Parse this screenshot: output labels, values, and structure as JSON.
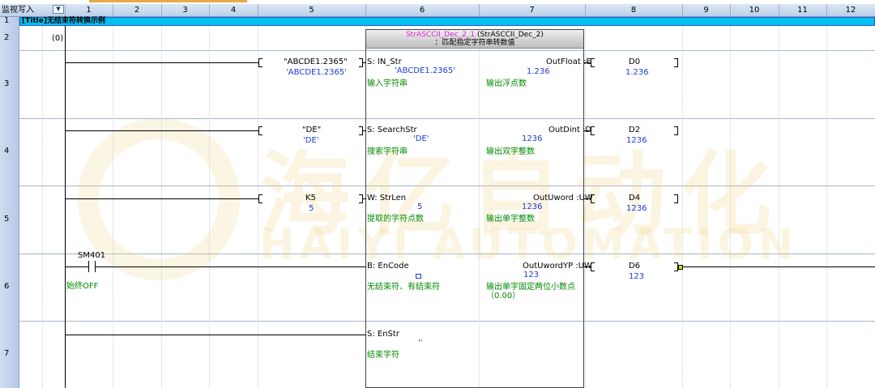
{
  "toolbar": {
    "mode_label": "监视写入",
    "dropdown_glyph": "▼"
  },
  "columns": [
    "1",
    "2",
    "3",
    "4",
    "5",
    "6",
    "7",
    "8",
    "9",
    "10",
    "11",
    "12"
  ],
  "rows": [
    {
      "num": "1"
    },
    {
      "num": "2"
    },
    {
      "num": "3"
    },
    {
      "num": "4"
    },
    {
      "num": "5"
    },
    {
      "num": "6"
    },
    {
      "num": "7"
    }
  ],
  "title_row": {
    "text": "[Title]无结束符转换示例"
  },
  "row2": {
    "step": "(0)"
  },
  "fb": {
    "instance": "StrASCCII_Dec_2_1",
    "type": "(StrASCCII_Dec_2)",
    "comment": "：匹配指定字符串转数值",
    "inputs": [
      {
        "pin": "S: IN_Str",
        "value": "'ABCDE1.2365'",
        "comment": "输入字符串"
      },
      {
        "pin": "S: SearchStr",
        "value": "'DE'",
        "comment": "搜索字符串"
      },
      {
        "pin": "W: StrLen",
        "value": "5",
        "comment": "提取的字符点数"
      },
      {
        "pin": "B: EnCode",
        "value": "",
        "comment": "无结束符、有结束符"
      },
      {
        "pin": "S: EnStr",
        "value": "''",
        "comment": "结束字符"
      }
    ],
    "outputs": [
      {
        "pin": "OutFloat :E",
        "value": "1.236",
        "comment": "输出浮点数"
      },
      {
        "pin": "OutDint :D",
        "value": "1236",
        "comment": "输出双字整数"
      },
      {
        "pin": "OutUword :UW",
        "value": "1236",
        "comment": "输出单字整数"
      },
      {
        "pin": "OutUwordYP :UW",
        "value": "123",
        "comment": "输出单字固定两位小数点",
        "comment2": "（0.00）"
      }
    ]
  },
  "left_operands": [
    {
      "name": "\"ABCDE1.2365\"",
      "value": "'ABCDE1.2365'"
    },
    {
      "name": "\"DE\"",
      "value": "'DE'"
    },
    {
      "name": "K5",
      "value": "5"
    }
  ],
  "right_devices": [
    {
      "name": "D0",
      "value": "1.236"
    },
    {
      "name": "D2",
      "value": "1236"
    },
    {
      "name": "D4",
      "value": "1236"
    },
    {
      "name": "D6",
      "value": "123"
    }
  ],
  "contact": {
    "device": "SM401",
    "comment": "始终OFF"
  },
  "watermark": {
    "cn": "海亿自动化",
    "en": "HAIYI AUTOMATION"
  }
}
